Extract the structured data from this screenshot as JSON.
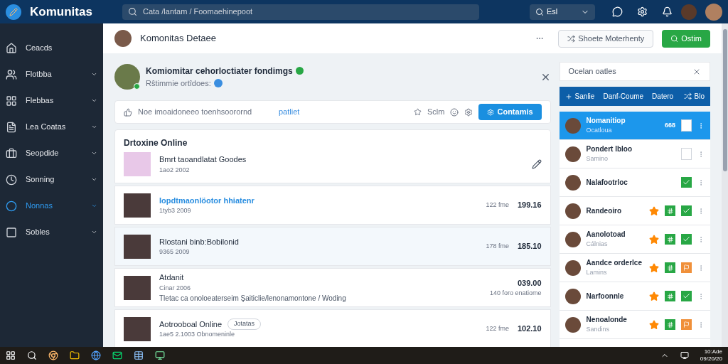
{
  "app": {
    "name": "Komunitas",
    "search_placeholder": "Cata /lantam / Foomaehinepoot",
    "filter": "Esl"
  },
  "sidebar": {
    "items": [
      {
        "label": "Ceacds",
        "selected": false,
        "expandable": false
      },
      {
        "label": "Flotbba",
        "selected": false,
        "expandable": true
      },
      {
        "label": "Flebbas",
        "selected": false,
        "expandable": true
      },
      {
        "label": "Lea Coatas",
        "selected": false,
        "expandable": true
      },
      {
        "label": "Seopdide",
        "selected": false,
        "expandable": true
      },
      {
        "label": "Sonning",
        "selected": false,
        "expandable": true
      },
      {
        "label": "Nonnas",
        "selected": true,
        "expandable": true
      },
      {
        "label": "Sobles",
        "selected": false,
        "expandable": true
      }
    ]
  },
  "header": {
    "title": "Komonitas Detaee",
    "buttons": [
      {
        "label": "Shoete Moterhenty",
        "kind": "outline"
      },
      {
        "label": "Ostim",
        "kind": "primary"
      }
    ]
  },
  "profile": {
    "name": "Komiomitar cehorloctiater fondimgs",
    "subtitle": "Rŝtimmie ortîdoes:"
  },
  "composer": {
    "placeholder": "Noe imoaidoneeo toenhsoorornd",
    "link": "patliet",
    "action": "Sclm",
    "button": "Contamis"
  },
  "feed": {
    "title": "Drtoxine Online",
    "items": [
      {
        "title": "Bmrt taoandlatat Goodes",
        "date": "1ao2 2002",
        "kind": "plain",
        "selected": false
      },
      {
        "title": "Iopdtmaonlöotor hhiatenr",
        "date": "1tyb3 2009",
        "duration": "122 fme",
        "amount": "199.16",
        "kind": "link",
        "selected": false
      },
      {
        "title": "Rlostani binb:Bobilonid",
        "date": "9365 2009",
        "duration": "178 fme",
        "amount": "185.10",
        "kind": "plain",
        "selected": true
      },
      {
        "title": "Atdanit",
        "date": "Cinar 2006",
        "description": "Tletac ca onoloeaterseim Şaiticlie/lenonamontone / Woding",
        "amount": "039.00",
        "amount_note": "140 foro enatiome",
        "kind": "plain",
        "selected": false
      },
      {
        "title": "Aotrooboal Online",
        "tag": "Jotatas",
        "date": "1ae5 2.1003 Obnomeninle",
        "duration": "122 fme",
        "amount": "102.10",
        "kind": "plain",
        "selected": false
      }
    ]
  },
  "people": {
    "search": "Ocelan oatles",
    "toolbar": [
      "Sanlie",
      "Danf-Coume",
      "Datero",
      "Blo"
    ],
    "items": [
      {
        "name": "Nomanitiop",
        "sub": "Ocatloua",
        "selected": true,
        "starred": false,
        "checked": false,
        "kind": "checkbox",
        "count": "668"
      },
      {
        "name": "Pondert Ibloo",
        "sub": "Samino",
        "selected": false,
        "starred": false,
        "checked": false,
        "kind": "checkbox"
      },
      {
        "name": "Nalafootrloc",
        "selected": false,
        "starred": false,
        "checked": true,
        "kind": "checkbox"
      },
      {
        "name": "Randeoiro",
        "selected": false,
        "starred": true,
        "checked": true,
        "kind": "checkbox"
      },
      {
        "name": "Aanolotoad",
        "sub": "Cálnias",
        "selected": false,
        "starred": true,
        "checked": true,
        "kind": "checkbox"
      },
      {
        "name": "Aandce orderlce",
        "sub": "Lamins",
        "selected": false,
        "starred": true,
        "kind": "flag"
      },
      {
        "name": "Narfoonnle",
        "selected": false,
        "starred": true,
        "checked": true,
        "kind": "checkbox"
      },
      {
        "name": "Nenoalonde",
        "sub": "Sandins",
        "selected": false,
        "starred": true,
        "kind": "flag"
      }
    ]
  },
  "taskbar": {
    "time": "10:Ade",
    "date": "09/20/20"
  }
}
